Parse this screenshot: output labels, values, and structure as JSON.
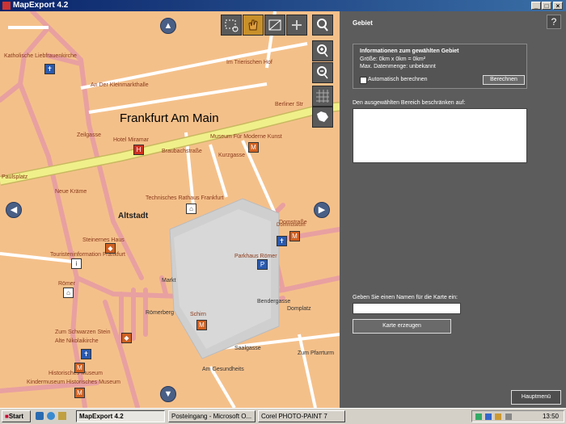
{
  "window": {
    "title": "MapExport 4.2"
  },
  "map": {
    "city_label": "Frankfurt Am Main",
    "district_label": "Altstadt",
    "streets": [
      "Katholische Liebfrauenkirche",
      "An Der Kleinmarkthalle",
      "Im Trierischen Hof",
      "Berliner Str",
      "Zeilgasse",
      "Hotel Miramar",
      "Braubachstraße",
      "Museum Für Moderne Kunst",
      "Kurzgasse",
      "Paulsplatz",
      "Neue Kräme",
      "Technisches Rathaus Frankfurt",
      "Domstraße",
      "Dommuseum",
      "Steinernes Haus",
      "Touristeninformation Frankfurt",
      "Parkhaus Römer",
      "Römer",
      "Markt",
      "Römerberg",
      "Schirn",
      "Bendergasse",
      "Domplatz",
      "Zum Schwarzen Stein",
      "Alte Nikolaikirche",
      "Saalgasse",
      "Historisches Museum",
      "Kindermuseum Historisches Museum",
      "Am Gesundheits",
      "Zum Pfarrturm"
    ],
    "tools": [
      "select-area-icon",
      "hand-pan-icon",
      "crop-icon",
      "arrows-icon",
      "magnifier-icon",
      "zoom-in-icon",
      "zoom-out-icon",
      "grid-icon",
      "europe-map-icon"
    ]
  },
  "panel": {
    "section_title": "Gebiet",
    "help_label": "?",
    "info_title": "Informationen zum gewählten Gebiet",
    "size_line": "Größe: 0km x 0km = 0km²",
    "max_line": "Max. Datenmenge: unbekannt",
    "auto_label": "Automatisch berechnen",
    "calc_button": "Berechnen",
    "restrict_label": "Den ausgewählten Bereich beschränken auf:",
    "name_label": "Geben Sie einen Namen für die Karte ein:",
    "name_value": "",
    "create_button": "Karte erzeugen",
    "main_menu_button": "Hauptmenü"
  },
  "taskbar": {
    "start": "Start",
    "tasks": [
      "MapExport 4.2",
      "Posteingang - Microsoft O...",
      "Corel PHOTO-PAINT 7"
    ],
    "clock": "13:50"
  },
  "colors": {
    "map_bg": "#f4c08a",
    "road_main": "#f0f08a",
    "road_pink": "#e8a0a0",
    "panel_bg": "#5c5c5c",
    "poi_red": "#d03020",
    "poi_blue": "#2a5ab0"
  }
}
